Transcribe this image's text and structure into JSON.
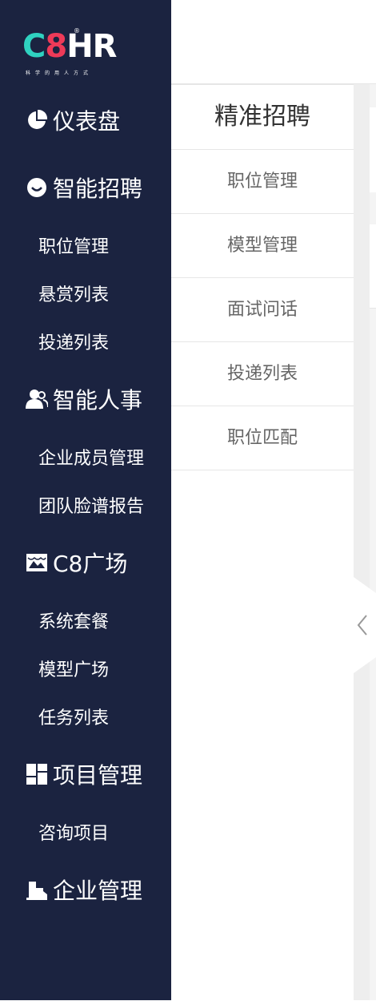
{
  "logo": {
    "brand_c": "C",
    "brand_8": "8",
    "brand_hr": "HR",
    "registered": "®",
    "tagline": "科学的用人方式"
  },
  "sidebar": {
    "sections": [
      {
        "label": "仪表盘",
        "icon": "pie-chart-icon"
      },
      {
        "label": "智能招聘",
        "icon": "smile-icon",
        "items": [
          "职位管理",
          "悬赏列表",
          "投递列表"
        ]
      },
      {
        "label": "智能人事",
        "icon": "users-icon",
        "items": [
          "企业成员管理",
          "团队脸谱报告"
        ]
      },
      {
        "label": "C8广场",
        "icon": "store-icon",
        "items": [
          "系统套餐",
          "模型广场",
          "任务列表"
        ]
      },
      {
        "label": "项目管理",
        "icon": "grid-icon",
        "items": [
          "咨询项目"
        ]
      },
      {
        "label": "企业管理",
        "icon": "building-icon"
      }
    ]
  },
  "submenu": {
    "title": "精准招聘",
    "items": [
      "职位管理",
      "模型管理",
      "面试问话",
      "投递列表",
      "职位匹配"
    ]
  },
  "collapse": {
    "icon": "chevron-left-icon"
  },
  "colors": {
    "sidebar_bg": "#1b2340",
    "logo_c": "#2fd2c0",
    "logo_8": "#ee3a58"
  }
}
